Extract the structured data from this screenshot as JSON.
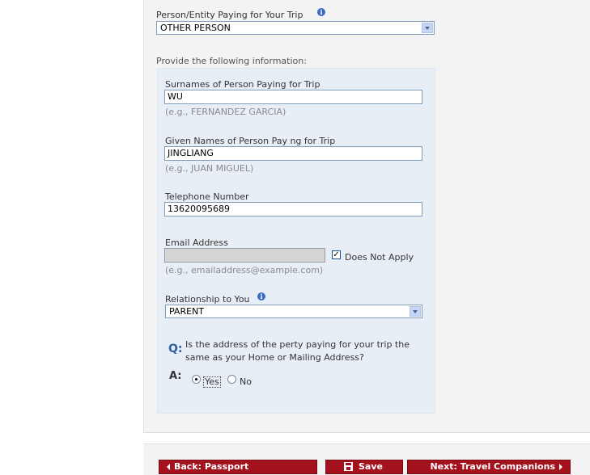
{
  "payer": {
    "label": "Person/Entity Paying for Your Trip",
    "value": "OTHER PERSON"
  },
  "provide_info": "Provide the following information:",
  "surnames": {
    "label": "Surnames of Person Paying for Trip",
    "value": "WU",
    "hint": "(e.g., FERNANDEZ GARCIA)"
  },
  "given": {
    "label": "Given Names of Person Pay ng for Trip",
    "value": "JINGLIANG",
    "hint": "(e.g., JUAN MIGUEL)"
  },
  "phone": {
    "label": "Telephone Number",
    "value": "13620095689"
  },
  "email": {
    "label": "Email Address",
    "value": "",
    "does_not_apply": "Does Not Apply",
    "does_not_apply_checked": true,
    "hint": "(e.g., emailaddress@example.com)"
  },
  "relationship": {
    "label": "Relationship to You",
    "value": "PARENT"
  },
  "address_question": {
    "q_marker": "Q:",
    "text_line1": "Is the address of the perty paying for your trip the",
    "text_line2": "same as your Home or Mailing Address?",
    "a_marker": "A:",
    "yes_label": "Yes",
    "no_label": "No",
    "selected": "Yes"
  },
  "nav": {
    "back_label": "Back: Passport",
    "save_label": "Save",
    "next_label": "Next: Travel Companions"
  },
  "colors": {
    "button_red": "#a3121d",
    "info_blue": "#3a6bc4",
    "panel_bg": "#e8eef5"
  }
}
